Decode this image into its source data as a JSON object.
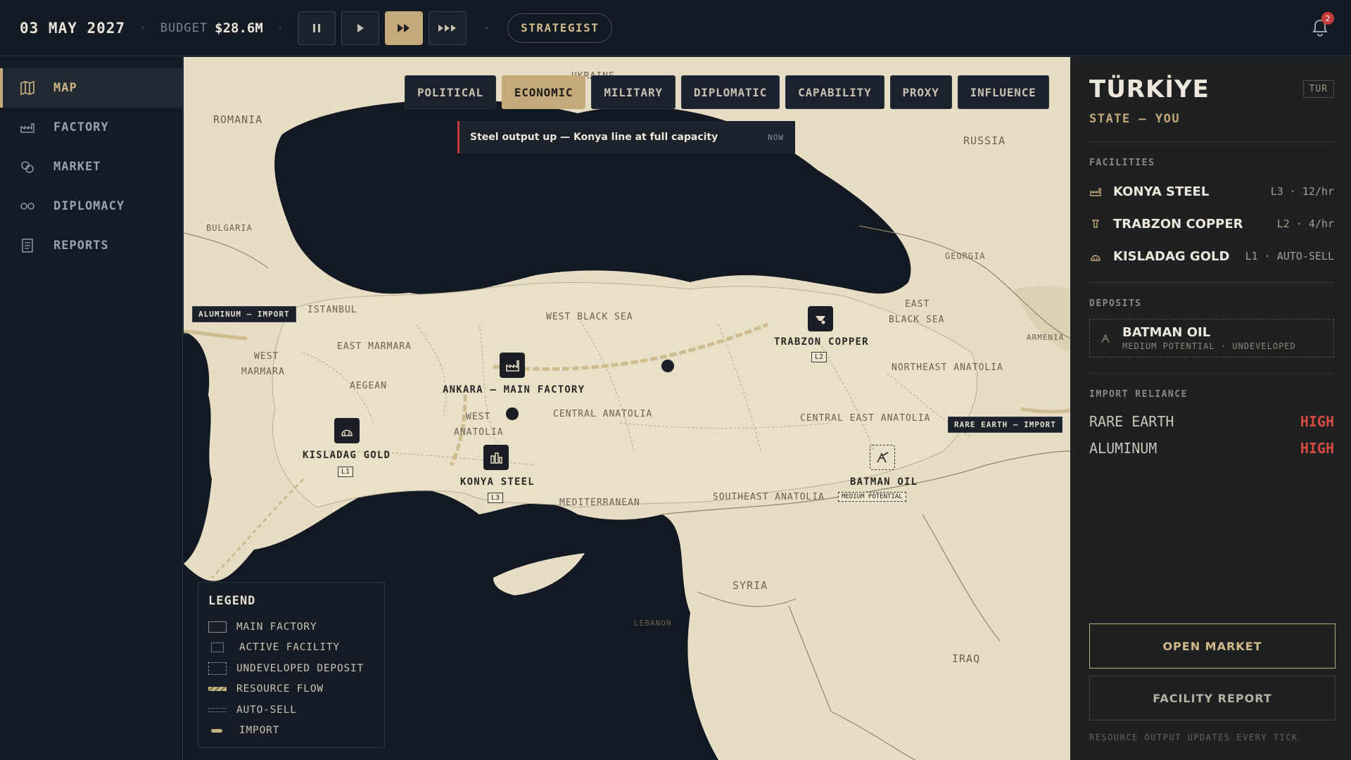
{
  "topbar": {
    "date": "03 MAY 2027",
    "budget_label": "BUDGET",
    "budget_value": "$28.6M",
    "separator": "·",
    "role": "STRATEGIST",
    "notifications": "2"
  },
  "sidebar": {
    "items": [
      {
        "label": "MAP",
        "icon": "map-icon",
        "active": true
      },
      {
        "label": "FACTORY",
        "icon": "factory-icon"
      },
      {
        "label": "MARKET",
        "icon": "market-icon"
      },
      {
        "label": "DIPLOMACY",
        "icon": "diplomacy-icon"
      },
      {
        "label": "REPORTS",
        "icon": "reports-icon"
      }
    ]
  },
  "map": {
    "layers": [
      "POLITICAL",
      "ECONOMIC",
      "MILITARY",
      "DIPLOMATIC",
      "CAPABILITY",
      "PROXY",
      "INFLUENCE"
    ],
    "active_layer": "ECONOMIC",
    "toast": {
      "message": "Steel output up — Konya line at full capacity",
      "time": "NOW"
    },
    "regions": {
      "romania": "ROMANIA",
      "ukraine": "UKRAINE",
      "russia": "RUSSIA",
      "bulgaria": "BULGARIA",
      "georgia": "GEORGIA",
      "armenia": "ARMENIA",
      "istanbul": "ISTANBUL",
      "west_marmara_1": "WEST",
      "west_marmara_2": "MARMARA",
      "east_marmara": "EAST MARMARA",
      "aegean": "AEGEAN",
      "west_black_sea": "WEST BLACK SEA",
      "east_black_sea_1": "EAST",
      "east_black_sea_2": "BLACK SEA",
      "northeast_anatolia": "NORTHEAST ANATOLIA",
      "central_anatolia": "CENTRAL ANATOLIA",
      "west_anatolia_1": "WEST",
      "west_anatolia_2": "ANATOLIA",
      "central_east_anatolia": "CENTRAL EAST ANATOLIA",
      "mediterranean": "MEDITERRANEAN",
      "southeast_anatolia": "SOUTHEAST ANATOLIA",
      "syria": "SYRIA",
      "lebanon": "LEBANON",
      "iraq": "IRAQ"
    },
    "facilities": {
      "ankara": "ANKARA — MAIN FACTORY",
      "kisladag": "KISLADAG GOLD",
      "kisladag_tier": "L1",
      "konya": "KONYA STEEL",
      "konya_tier": "L3",
      "trabzon": "TRABZON COPPER",
      "trabzon_tier": "L2",
      "batman": "BATMAN OIL",
      "batman_tag": "MEDIUM POTENTIAL"
    },
    "imports": {
      "aluminum": "ALUMINUM — IMPORT",
      "rare_earth": "RARE EARTH — IMPORT"
    },
    "legend": {
      "title": "LEGEND",
      "items": [
        "MAIN FACTORY",
        "ACTIVE FACILITY",
        "UNDEVELOPED DEPOSIT",
        "RESOURCE FLOW",
        "AUTO-SELL",
        "IMPORT"
      ]
    }
  },
  "panel": {
    "country": "TÜRKİYE",
    "code": "TUR",
    "subtitle": "STATE — YOU",
    "facilities_header": "FACILITIES",
    "facilities": [
      {
        "name": "KONYA STEEL",
        "meta": "L3 · 12/hr",
        "icon": "factory-icon"
      },
      {
        "name": "TRABZON COPPER",
        "meta": "L2 · 4/hr",
        "icon": "mine-icon"
      },
      {
        "name": "KISLADAG GOLD",
        "meta": "L1 · AUTO-SELL",
        "icon": "gold-icon"
      }
    ],
    "deposits_header": "DEPOSITS",
    "deposit": {
      "name": "BATMAN OIL",
      "meta": "MEDIUM POTENTIAL · UNDEVELOPED"
    },
    "reliance_header": "IMPORT RELIANCE",
    "reliance": [
      {
        "resource": "RARE EARTH",
        "level": "HIGH"
      },
      {
        "resource": "ALUMINUM",
        "level": "HIGH"
      }
    ],
    "open_market": "OPEN MARKET",
    "facility_report": "FACILITY REPORT",
    "footer": "RESOURCE OUTPUT UPDATES EVERY TICK"
  },
  "colors": {
    "accent": "#c4a97a",
    "alert": "#d64a3f",
    "sea": "#121821",
    "land": "#e7ddc4"
  }
}
